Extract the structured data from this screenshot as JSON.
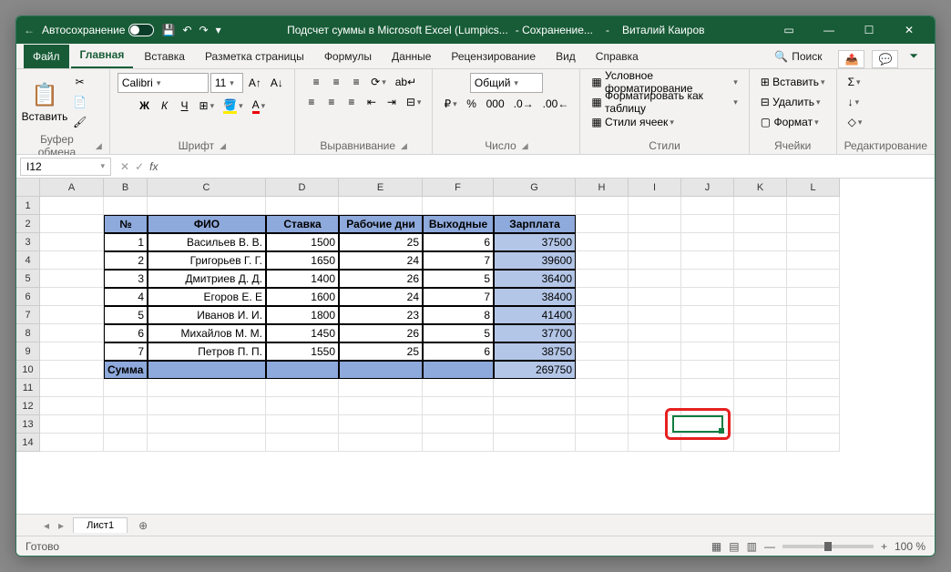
{
  "titlebar": {
    "autosave": "Автосохранение",
    "doc_title": "Подсчет суммы в Microsoft Excel (Lumpics...",
    "saving": "- Сохранение...",
    "user": "Виталий Каиров"
  },
  "tabs": {
    "file": "Файл",
    "home": "Главная",
    "insert": "Вставка",
    "layout": "Разметка страницы",
    "formulas": "Формулы",
    "data": "Данные",
    "review": "Рецензирование",
    "view": "Вид",
    "help": "Справка",
    "search": "Поиск"
  },
  "ribbon": {
    "paste": "Вставить",
    "clipboard": "Буфер обмена",
    "font_name": "Calibri",
    "font_size": "11",
    "font": "Шрифт",
    "align": "Выравнивание",
    "format_label": "Общий",
    "number": "Число",
    "cond_fmt": "Условное форматирование",
    "as_table": "Форматировать как таблицу",
    "cell_styles": "Стили ячеек",
    "styles": "Стили",
    "insert_cells": "Вставить",
    "delete_cells": "Удалить",
    "format_cells": "Формат",
    "cells": "Ячейки",
    "editing": "Редактирование"
  },
  "formula": {
    "cell_ref": "I12"
  },
  "columns": [
    "",
    "A",
    "B",
    "C",
    "D",
    "E",
    "F",
    "G",
    "H",
    "I",
    "J",
    "K",
    "L"
  ],
  "rows": [
    "1",
    "2",
    "3",
    "4",
    "5",
    "6",
    "7",
    "8",
    "9",
    "10",
    "11",
    "12",
    "13",
    "14"
  ],
  "table": {
    "headers": {
      "num": "№",
      "fio": "ФИО",
      "rate": "Ставка",
      "workdays": "Рабочие дни",
      "weekends": "Выходные",
      "salary": "Зарплата"
    },
    "data": [
      {
        "num": "1",
        "fio": "Васильев В. В.",
        "rate": "1500",
        "workdays": "25",
        "weekends": "6",
        "salary": "37500"
      },
      {
        "num": "2",
        "fio": "Григорьев Г. Г.",
        "rate": "1650",
        "workdays": "24",
        "weekends": "7",
        "salary": "39600"
      },
      {
        "num": "3",
        "fio": "Дмитриев Д. Д.",
        "rate": "1400",
        "workdays": "26",
        "weekends": "5",
        "salary": "36400"
      },
      {
        "num": "4",
        "fio": "Егоров Е. Е",
        "rate": "1600",
        "workdays": "24",
        "weekends": "7",
        "salary": "38400"
      },
      {
        "num": "5",
        "fio": "Иванов И. И.",
        "rate": "1800",
        "workdays": "23",
        "weekends": "8",
        "salary": "41400"
      },
      {
        "num": "6",
        "fio": "Михайлов М. М.",
        "rate": "1450",
        "workdays": "26",
        "weekends": "5",
        "salary": "37700"
      },
      {
        "num": "7",
        "fio": "Петров П. П.",
        "rate": "1550",
        "workdays": "25",
        "weekends": "6",
        "salary": "38750"
      }
    ],
    "sum_label": "Сумма",
    "sum_value": "269750"
  },
  "sheet": {
    "tab1": "Лист1"
  },
  "status": {
    "ready": "Готово",
    "zoom": "100 %"
  }
}
